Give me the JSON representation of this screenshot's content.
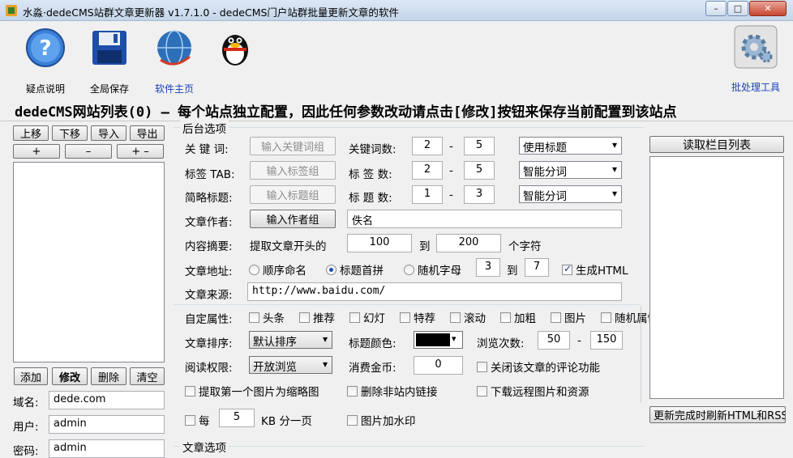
{
  "window": {
    "title": "水淼·dedeCMS站群文章更新器 v1.7.1.0 - dedeCMS门户站群批量更新文章的软件",
    "min": "–",
    "max": "□",
    "close": "✕"
  },
  "toolbar": {
    "help": "疑点说明",
    "save": "全局保存",
    "home": "软件主页",
    "batch": "批处理工具"
  },
  "heading": "dedeCMS网站列表(0) – 每个站点独立配置，因此任何参数改动请点击[修改]按钮来保存当前配置到该站点",
  "left": {
    "up": "上移",
    "down": "下移",
    "import": "导入",
    "export": "导出",
    "plus": "+",
    "minus": "–",
    "plusminus": "+ –",
    "add": "添加",
    "modify": "修改",
    "delete": "删除",
    "clear": "清空",
    "domain_label": "域名:",
    "domain": "dede.com",
    "user_label": "用户:",
    "user": "admin",
    "pass_label": "密码:",
    "pass": "admin"
  },
  "backend": {
    "group": "后台选项",
    "keyword_label": "关 键 词:",
    "keyword_btn": "输入关键词组",
    "keyword_count_label": "关键词数:",
    "kw_min": "2",
    "kw_max": "5",
    "kw_mode": "使用标题",
    "tag_label": "标签 TAB:",
    "tag_btn": "输入标签组",
    "tag_count_label": "标 签 数:",
    "tag_min": "2",
    "tag_max": "5",
    "tag_mode": "智能分词",
    "short_label": "简略标题:",
    "short_btn": "输入标题组",
    "title_count_label": "标 题 数:",
    "title_min": "1",
    "title_max": "3",
    "title_mode": "智能分词",
    "author_label": "文章作者:",
    "author_btn": "输入作者组",
    "author": "佚名",
    "summary_label": "内容摘要:",
    "summary_text": "提取文章开头的",
    "sum_min": "100",
    "to": "到",
    "sum_max": "200",
    "chars": "个字符",
    "url_label": "文章地址:",
    "url_seq": "顺序命名",
    "url_pinyin": "标题首拼",
    "url_rand": "随机字母",
    "rand_min": "3",
    "rand_max": "7",
    "gen_html": "生成HTML",
    "source_label": "文章来源:",
    "source": "http://www.baidu.com/",
    "dash": "-",
    "attr_label": "自定属性:",
    "attrs": [
      "头条",
      "推荐",
      "幻灯",
      "特荐",
      "滚动",
      "加粗",
      "图片",
      "随机属性"
    ],
    "sort_label": "文章排序:",
    "sort": "默认排序",
    "color_label": "标题颜色:",
    "views_label": "浏览次数:",
    "views_min": "50",
    "views_max": "150",
    "read_label": "阅读权限:",
    "read": "开放浏览",
    "coin_label": "消费金币:",
    "coin": "0",
    "close_comment": "关闭该文章的评论功能",
    "thumb": "提取第一个图片为缩略图",
    "del_links": "删除非站内链接",
    "download": "下载远程图片和资源",
    "every": "每",
    "every_kb": "5",
    "kb_text": "KB 分一页",
    "watermark": "图片加水印"
  },
  "article_group": "文章选项",
  "right": {
    "read_cols": "读取栏目列表",
    "refresh": "更新完成时刷新HTML和RSS"
  },
  "colors": {
    "title_color": "#000000",
    "link": "#1a3fb8"
  }
}
